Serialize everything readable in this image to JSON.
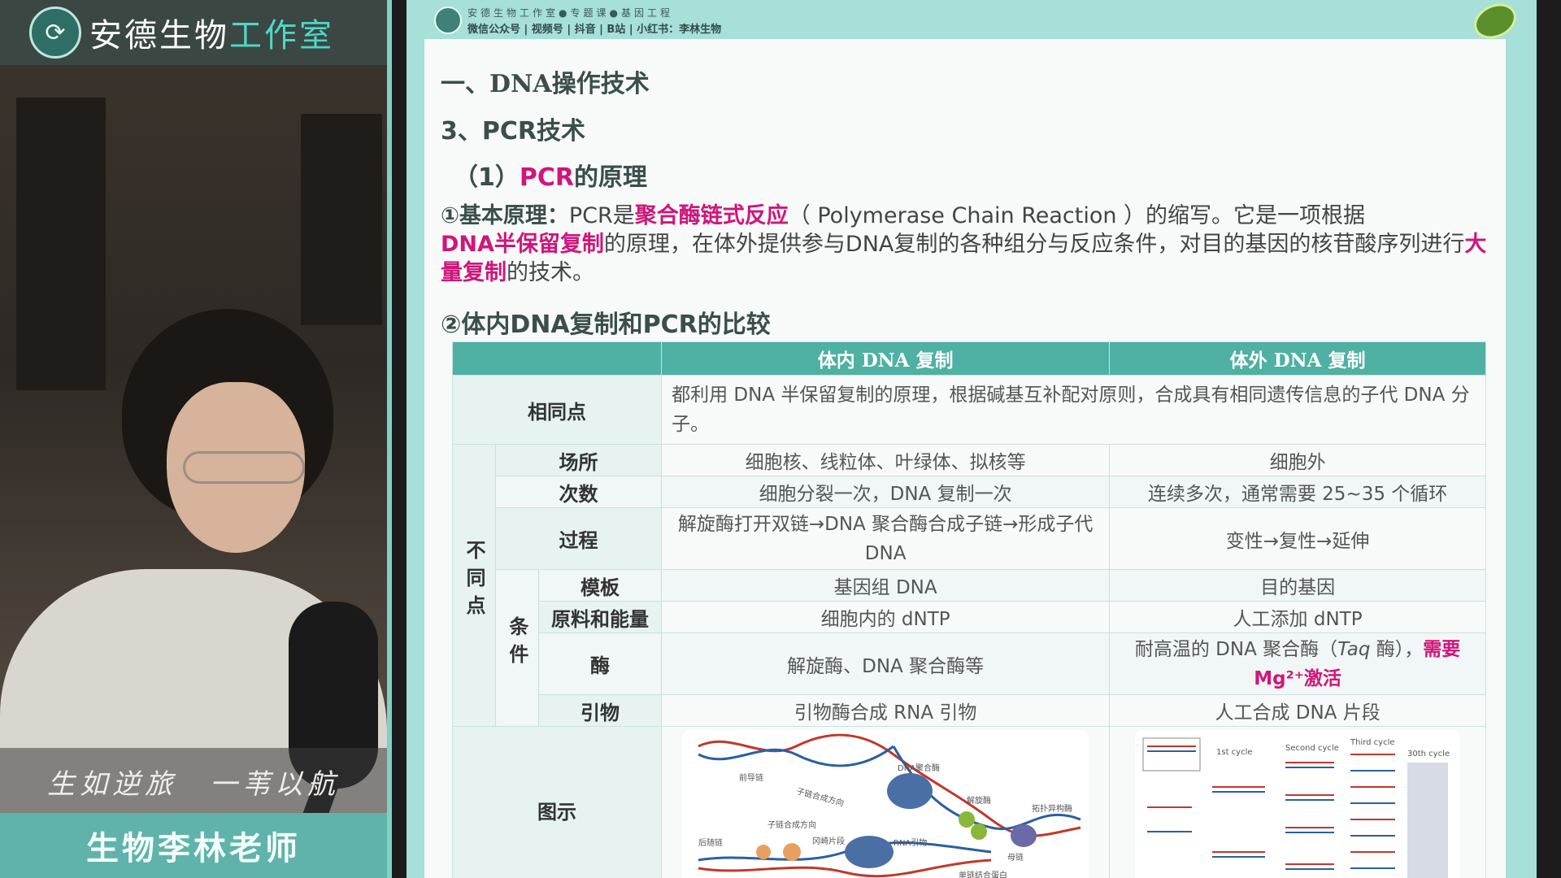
{
  "sidebar": {
    "logo_main": "安德生物",
    "logo_accent": "工作室",
    "motto": "生如逆旅　一苇以航",
    "teacher_name": "生物李林老师"
  },
  "slide": {
    "brand_line1": "安德生物工作室●专题课●基因工程",
    "brand_line2": "微信公众号 | 视频号 | 抖音 | B站 | 小红书：李林生物",
    "h1": "一、DNA操作技术",
    "h2": "3、PCR技术",
    "h3_prefix": "（1）",
    "h3_pink": "PCR",
    "h3_rest": "的原理",
    "para": {
      "label": "①基本原理：",
      "t1": "PCR是",
      "k1": "聚合酶链式反应",
      "t2": "（ Polymerase Chain Reaction ）的缩写。它是一项根据",
      "k2": "DNA半保留复制",
      "t3": "的原理，在体外提供参与DNA复制的各种组分与反应条件，对目的基因的核苷酸序列进行",
      "k3": "大量复制",
      "t4": "的技术。"
    },
    "h4": "②体内DNA复制和PCR的比较"
  },
  "table": {
    "col_in": "体内 DNA 复制",
    "col_out": "体外 DNA 复制",
    "same_label": "相同点",
    "same_text": "都利用 DNA 半保留复制的原理，根据碱基互补配对原则，合成具有相同遗传信息的子代 DNA 分子。",
    "diff_label": "不同点",
    "cond_label": "条件",
    "rows": {
      "place": {
        "label": "场所",
        "in": "细胞核、线粒体、叶绿体、拟核等",
        "out": "细胞外"
      },
      "times": {
        "label": "次数",
        "in": "细胞分裂一次，DNA 复制一次",
        "out": "连续多次，通常需要 25~35 个循环"
      },
      "process": {
        "label": "过程",
        "in": "解旋酶打开双链→DNA 聚合酶合成子链→形成子代 DNA",
        "out": "变性→复性→延伸"
      },
      "template": {
        "label": "模板",
        "in": "基因组 DNA",
        "out": "目的基因"
      },
      "material": {
        "label": "原料和能量",
        "in": "细胞内的 dNTP",
        "out": "人工添加 dNTP"
      },
      "enzyme": {
        "label": "酶",
        "in": "解旋酶、DNA 聚合酶等",
        "out_a": "耐高温的 DNA 聚合酶（",
        "out_taq": "Taq",
        "out_b": " 酶），",
        "out_pink": "需要 Mg²⁺激活"
      },
      "primer": {
        "label": "引物",
        "in": "引物酶合成 RNA 引物",
        "out": "人工合成 DNA 片段"
      },
      "figure": {
        "label": "图示"
      }
    },
    "fig_in_labels": [
      "DNA聚合酶",
      "前导链",
      "子链合成方向",
      "解旋酶",
      "拓扑异构酶",
      "子链合成方向",
      "后随链",
      "冈崎片段",
      "RNA引物",
      "母链",
      "单链结合蛋白"
    ],
    "fig_out_labels": [
      "1st cycle",
      "Second cycle",
      "Third cycle",
      "30th cycle"
    ]
  },
  "colors": {
    "accent_teal": "#4fb0a4",
    "highlight_pink": "#d0157b",
    "slide_bg": "#a7dfd9"
  }
}
